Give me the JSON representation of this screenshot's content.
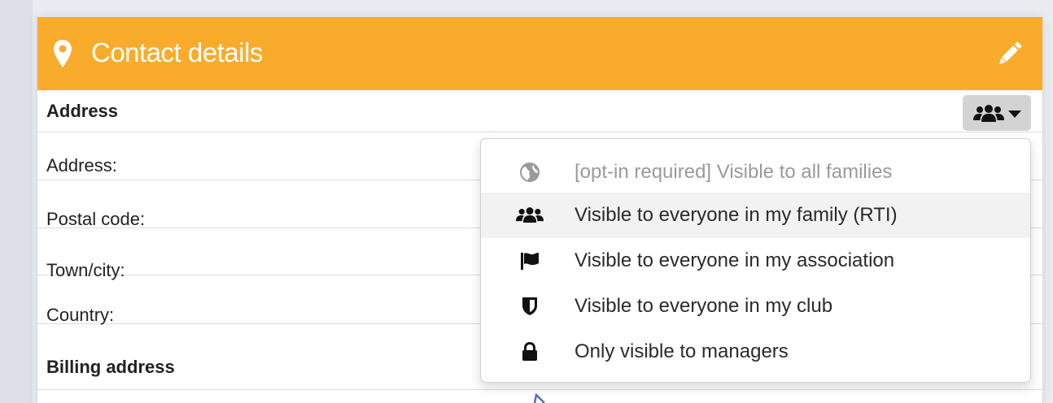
{
  "header": {
    "title": "Contact details",
    "icon_left": "map-marker-icon",
    "icon_right": "pencil-icon"
  },
  "sections": {
    "address": {
      "label": "Address",
      "visibility_icon": "group-icon"
    },
    "billing": {
      "label": "Billing address"
    }
  },
  "fields": [
    {
      "label": "Address:"
    },
    {
      "label": "Postal code:"
    },
    {
      "label": "Town/city:"
    },
    {
      "label": "Country:"
    }
  ],
  "visibility_menu": {
    "items": [
      {
        "label": "[opt-in required] Visible to all families",
        "icon": "globe-icon",
        "disabled": true
      },
      {
        "label": "Visible to everyone in my family (RTI)",
        "icon": "group-icon",
        "active": true
      },
      {
        "label": "Visible to everyone in my association",
        "icon": "flag-icon"
      },
      {
        "label": "Visible to everyone in my club",
        "icon": "shield-icon"
      },
      {
        "label": "Only visible to managers",
        "icon": "lock-icon"
      }
    ]
  },
  "colors": {
    "header": "#f9ac2b",
    "active_row": "#f2f2f2",
    "disabled_text": "#9a9a9a"
  }
}
